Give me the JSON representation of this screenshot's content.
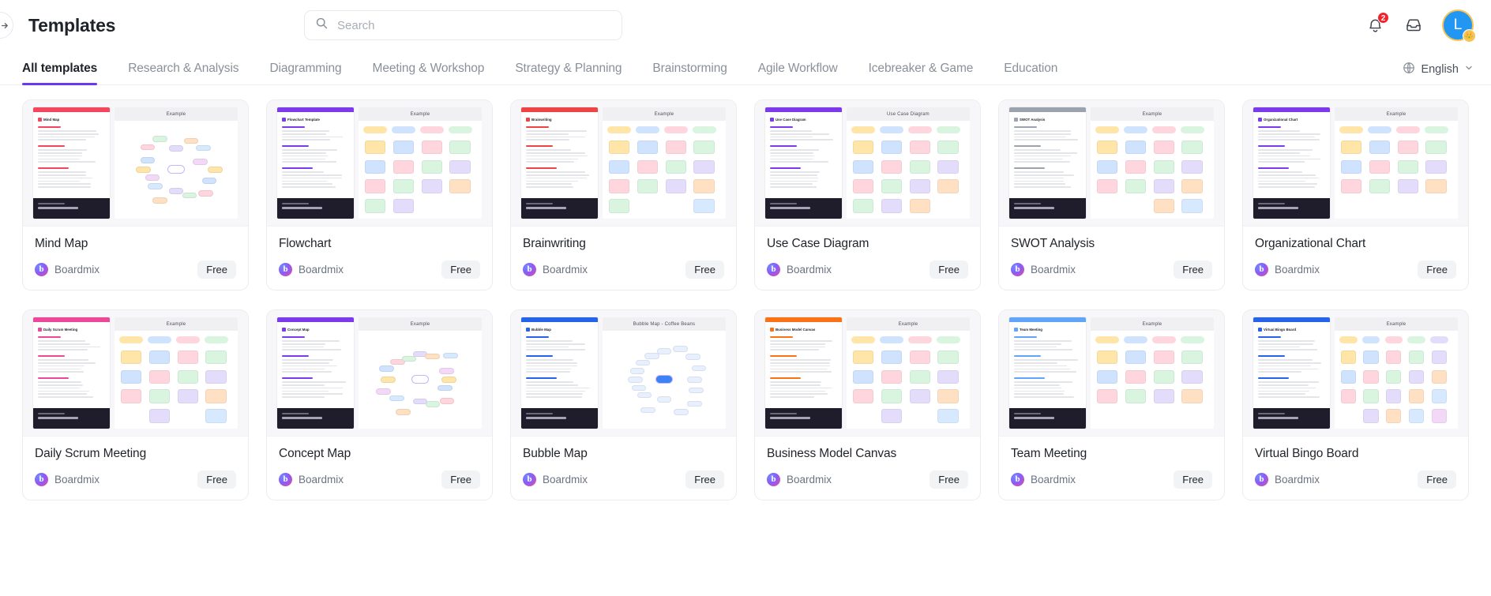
{
  "header": {
    "collapse_icon": "sidebar-expand-icon",
    "title": "Templates",
    "search": {
      "value": "",
      "placeholder": "Search",
      "icon": "search-icon"
    },
    "notifications": {
      "icon": "bell-icon",
      "count": "2"
    },
    "inbox": {
      "icon": "inbox-icon"
    },
    "avatar": {
      "initial": "L",
      "badge_icon": "crown-icon",
      "bg": "#2196f3",
      "ring": "#f5c452"
    }
  },
  "tabs": {
    "items": [
      {
        "label": "All templates",
        "active": true
      },
      {
        "label": "Research & Analysis",
        "active": false
      },
      {
        "label": "Diagramming",
        "active": false
      },
      {
        "label": "Meeting & Workshop",
        "active": false
      },
      {
        "label": "Strategy & Planning",
        "active": false
      },
      {
        "label": "Brainstorming",
        "active": false
      },
      {
        "label": "Agile Workflow",
        "active": false
      },
      {
        "label": "Icebreaker & Game",
        "active": false
      },
      {
        "label": "Education",
        "active": false
      }
    ],
    "active_color": "#6938ef",
    "language": {
      "label": "English",
      "icon": "globe-icon",
      "chevron": "chevron-down-icon"
    }
  },
  "cards": [
    {
      "title": "Mind Map",
      "author": "Boardmix",
      "price": "Free",
      "thumb_label": "Example",
      "doc_title": "Mind Map",
      "accent": "#f5455f",
      "doc_mark": "#f5455f"
    },
    {
      "title": "Flowchart",
      "author": "Boardmix",
      "price": "Free",
      "thumb_label": "Example",
      "doc_title": "Flowchart Template",
      "accent": "#7c3aed",
      "doc_mark": "#7c3aed"
    },
    {
      "title": "Brainwriting",
      "author": "Boardmix",
      "price": "Free",
      "thumb_label": "Example",
      "doc_title": "Brainwriting",
      "accent": "#ef4444",
      "doc_mark": "#ef4444"
    },
    {
      "title": "Use Case Diagram",
      "author": "Boardmix",
      "price": "Free",
      "thumb_label": "Use Case Diagram",
      "doc_title": "Use Case Diagram",
      "accent": "#7c3aed",
      "doc_mark": "#7c3aed"
    },
    {
      "title": "SWOT Analysis",
      "author": "Boardmix",
      "price": "Free",
      "thumb_label": "Example",
      "doc_title": "SWOT Analysis",
      "accent": "#9ca3af",
      "doc_mark": "#9ca3af"
    },
    {
      "title": "Organizational Chart",
      "author": "Boardmix",
      "price": "Free",
      "thumb_label": "Example",
      "doc_title": "Organizational Chart",
      "accent": "#7c3aed",
      "doc_mark": "#7c3aed"
    },
    {
      "title": "Daily Scrum Meeting",
      "author": "Boardmix",
      "price": "Free",
      "thumb_label": "Example",
      "doc_title": "Daily Scrum Meeting",
      "accent": "#ec4899",
      "doc_mark": "#ec4899"
    },
    {
      "title": "Concept Map",
      "author": "Boardmix",
      "price": "Free",
      "thumb_label": "Example",
      "doc_title": "Concept Map",
      "accent": "#7c3aed",
      "doc_mark": "#7c3aed"
    },
    {
      "title": "Bubble Map",
      "author": "Boardmix",
      "price": "Free",
      "thumb_label": "Bubble Map - Coffee Beans",
      "doc_title": "Bubble Map",
      "accent": "#2563eb",
      "doc_mark": "#2563eb"
    },
    {
      "title": "Business Model Canvas",
      "author": "Boardmix",
      "price": "Free",
      "thumb_label": "Example",
      "doc_title": "Business Model Canvas",
      "accent": "#f97316",
      "doc_mark": "#f97316"
    },
    {
      "title": "Team Meeting",
      "author": "Boardmix",
      "price": "Free",
      "thumb_label": "Example",
      "doc_title": "Team Meeting",
      "accent": "#60a5fa",
      "doc_mark": "#60a5fa"
    },
    {
      "title": "Virtual Bingo Board",
      "author": "Boardmix",
      "price": "Free",
      "thumb_label": "Example",
      "doc_title": "Virtual Bingo Board",
      "accent": "#2563eb",
      "doc_mark": "#2563eb"
    }
  ]
}
